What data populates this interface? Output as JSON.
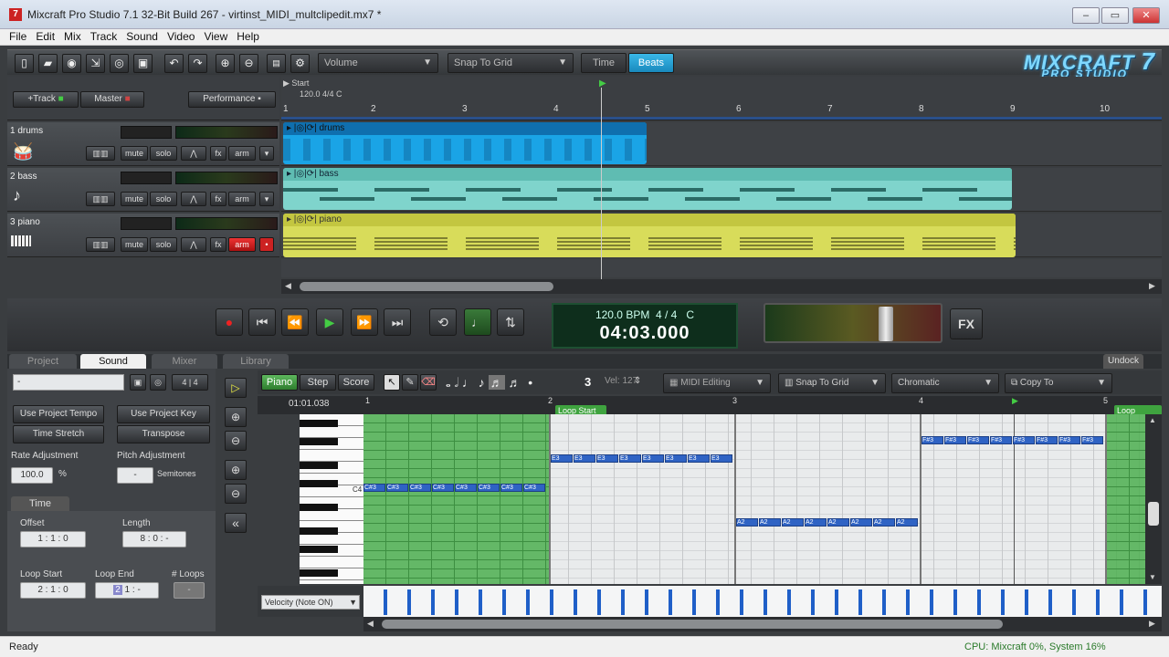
{
  "window": {
    "title": "Mixcraft Pro Studio 7.1 32-Bit Build 267 - virtinst_MIDI_multclipedit.mx7 *",
    "app_icon": "7"
  },
  "menu": [
    "File",
    "Edit",
    "Mix",
    "Track",
    "Sound",
    "Video",
    "View",
    "Help"
  ],
  "toolbar": {
    "param_dropdown": "Volume",
    "snap_dropdown": "Snap To Grid",
    "time_btn": "Time",
    "beats_btn": "Beats",
    "logo_main": "MIXCRAFT",
    "logo_sub": "PRO STUDIO",
    "logo_num": "7"
  },
  "track_header": {
    "add_track": "+Track",
    "master": "Master",
    "performance": "Performance"
  },
  "ruler": {
    "start_label": "Start",
    "tempo_info": "120.0 4/4 C",
    "bars": [
      "1",
      "2",
      "3",
      "4",
      "5",
      "6",
      "7",
      "8",
      "9",
      "10"
    ]
  },
  "tracks": [
    {
      "name": "1 drums",
      "clip": "drums",
      "mute": "mute",
      "solo": "solo",
      "fx": "fx",
      "arm": "arm",
      "armed": false
    },
    {
      "name": "2 bass",
      "clip": "bass",
      "mute": "mute",
      "solo": "solo",
      "fx": "fx",
      "arm": "arm",
      "armed": false
    },
    {
      "name": "3 piano",
      "clip": "piano",
      "mute": "mute",
      "solo": "solo",
      "fx": "fx",
      "arm": "arm",
      "armed": true
    }
  ],
  "transport": {
    "bpm_line": "120.0 BPM",
    "meter": "4 / 4",
    "key": "C",
    "position": "04:03.000",
    "fx": "FX"
  },
  "bottom_tabs": [
    "Project",
    "Sound",
    "Mixer",
    "Library"
  ],
  "undock": "Undock",
  "sound_panel": {
    "meter_display": "4 | 4",
    "use_project_tempo": "Use Project Tempo",
    "time_stretch": "Time Stretch",
    "use_project_key": "Use Project Key",
    "transpose": "Transpose",
    "rate_adjustment_label": "Rate Adjustment",
    "rate_value": "100.0",
    "rate_unit": "%",
    "pitch_adjustment_label": "Pitch Adjustment",
    "pitch_value": "-",
    "pitch_unit": "Semitones",
    "time_tab": "Time",
    "offset_label": "Offset",
    "offset_value": "1 : 1 : 0",
    "length_label": "Length",
    "length_value": "8 : 0 : -",
    "loop_start_label": "Loop Start",
    "loop_start_value": "2 : 1 : 0",
    "loop_end_label": "Loop End",
    "loop_end_value": "1 : -",
    "loops_label": "# Loops",
    "loops_value": "-"
  },
  "piano_roll": {
    "mode_piano": "Piano",
    "mode_step": "Step",
    "mode_score": "Score",
    "quant": "3",
    "velocity": "Vel: 127",
    "midi_editing": "MIDI Editing",
    "snap": "Snap To Grid",
    "scale": "Chromatic",
    "copy_to": "Copy To",
    "position": "01:01.038",
    "bars": [
      "1",
      "2",
      "3",
      "4",
      "5"
    ],
    "loop_start": "Loop Start",
    "loop_end": "Loop",
    "c_label": "C4",
    "velocity_dropdown": "Velocity (Note ON)",
    "notes_c": "C#3",
    "notes_e": "E3",
    "notes_a": "A2",
    "notes_f": "F#3"
  },
  "status": {
    "left": "Ready",
    "right": "CPU: Mixcraft 0%, System 16%"
  },
  "colors": {
    "drums": "#1aa4e6",
    "bass": "#7fd4cc",
    "piano": "#d8dc5a",
    "green": "#4caf50",
    "note": "#2f63c4"
  }
}
